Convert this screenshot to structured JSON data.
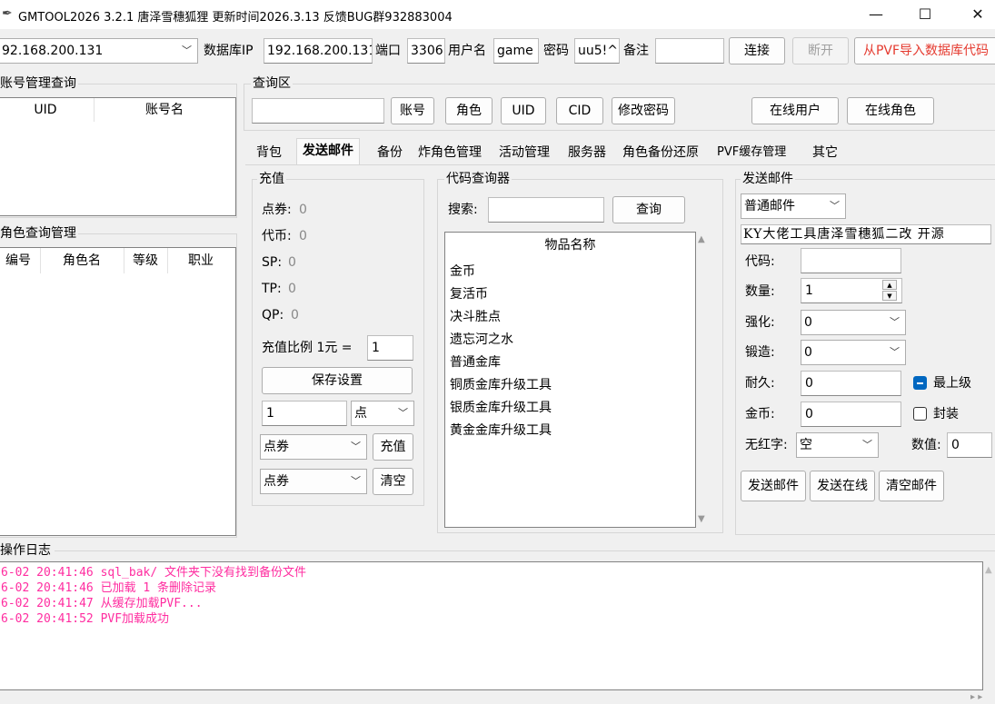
{
  "window": {
    "title": "GMTOOL2026   3.2.1  唐泽雪穗狐狸  更新时间2026.3.13 反馈BUG群932883004",
    "minimize": "—",
    "maximize": "☐",
    "close": "✕"
  },
  "connection": {
    "server_select": "92.168.200.131",
    "db_ip_label": "数据库IP",
    "db_ip": "192.168.200.131",
    "port_label": "端口",
    "port": "3306",
    "user_label": "用户名",
    "user": "game",
    "pwd_label": "密码",
    "pwd": "uu5!^",
    "note_label": "备注",
    "note": "",
    "connect": "连接",
    "disconnect": "断开",
    "import_pvf": "从PVF导入数据库代码"
  },
  "account_panel": {
    "title": "账号管理查询",
    "columns": [
      "UID",
      "账号名"
    ]
  },
  "role_panel": {
    "title": "角色查询管理",
    "columns": [
      "编号",
      "角色名",
      "等级",
      "职业"
    ]
  },
  "query": {
    "title": "查询区",
    "input": "",
    "buttons": [
      "账号",
      "角色",
      "UID",
      "CID",
      "修改密码"
    ],
    "online_users": "在线用户",
    "online_roles": "在线角色"
  },
  "tabs": [
    "背包",
    "发送邮件",
    "备份",
    "炸角色管理",
    "活动管理",
    "服务器",
    "角色备份还原",
    "PVF缓存管理",
    "其它"
  ],
  "recharge": {
    "title": "充值",
    "dianquan_label": "点券:",
    "dianquan": "0",
    "daibi_label": "代币:",
    "daibi": "0",
    "sp_label": "SP:",
    "sp": "0",
    "tp_label": "TP:",
    "tp": "0",
    "qp_label": "QP:",
    "qp": "0",
    "ratio_label": "充值比例 1元 =",
    "ratio": "1",
    "save": "保存设置",
    "amount": "1",
    "unit": "点",
    "type1": "点券",
    "charge": "充值",
    "type2": "点券",
    "clear": "清空"
  },
  "code_query": {
    "title": "代码查询器",
    "search_label": "搜索:",
    "search_value": "",
    "query_btn": "查询",
    "column": "物品名称",
    "items": [
      "金币",
      "复活币",
      "决斗胜点",
      "遗忘河之水",
      "普通金库",
      "铜质金库升级工具",
      "银质金库升级工具",
      "黄金金库升级工具"
    ]
  },
  "mail": {
    "title": "发送邮件",
    "mail_type": "普通邮件",
    "subject": "KY大佬工具唐泽雪穗狐二改 开源",
    "code_label": "代码:",
    "code": "",
    "qty_label": "数量:",
    "qty": "1",
    "enhance_label": "强化:",
    "enhance": "0",
    "forge_label": "锻造:",
    "forge": "0",
    "durability_label": "耐久:",
    "durability": "0",
    "max_level_label": "最上级",
    "max_level": true,
    "gold_label": "金币:",
    "gold": "0",
    "seal_label": "封装",
    "seal": false,
    "red_label": "无红字:",
    "red": "空",
    "value_label": "数值:",
    "value": "0",
    "send": "发送邮件",
    "send_online": "发送在线",
    "clear_mail": "清空邮件"
  },
  "log": {
    "title": "操作日志",
    "lines": [
      "6-02 20:41:46 sql_bak/ 文件夹下没有找到备份文件",
      "6-02 20:41:46 已加载 1 条删除记录",
      "6-02 20:41:47 从缓存加载PVF...",
      "6-02 20:41:52 PVF加载成功"
    ]
  },
  "colors": {
    "log_text": "#ff2da0",
    "import_text": "#e53a2f",
    "checkbox_on": "#0067c0"
  }
}
